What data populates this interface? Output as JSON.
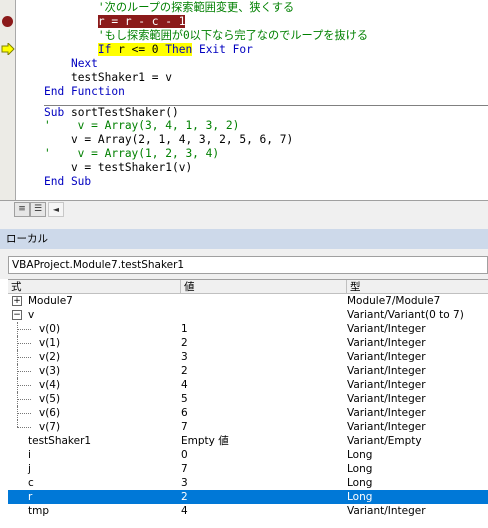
{
  "code": {
    "lines": [
      {
        "indent": "        ",
        "comment": "'次のループの探索範囲変更、狭くする"
      },
      {
        "indent": "        ",
        "hl_red": "r = r - c - 1"
      },
      {
        "indent": "        ",
        "comment": "'もし探索範囲が0以下なら完了なのでループを抜ける"
      },
      {
        "indent": "        ",
        "kw_if": "If",
        "expr": " r <= 0 ",
        "kw_then": "Then",
        "rest": " Exit For"
      },
      {
        "indent": "    ",
        "kw": "Next"
      },
      {
        "indent": "    ",
        "plain": "testShaker1 = v"
      },
      {
        "indent": "",
        "kw": "End Function"
      },
      {
        "indent": "",
        "kw": "Sub",
        "plain": " sortTestShaker()"
      },
      {
        "indent": "",
        "comment": "'    v = Array(3, 4, 1, 3, 2)"
      },
      {
        "indent": "    ",
        "plain": "v = Array(2, 1, 4, 3, 2, 5, 6, 7)"
      },
      {
        "indent": "",
        "comment": "'    v = Array(1, 2, 3, 4)"
      },
      {
        "indent": "    ",
        "plain": "v = testShaker1(v)"
      },
      {
        "indent": "",
        "kw": "End Sub"
      }
    ],
    "view_buttons": [
      "≡",
      "☰"
    ],
    "scroll_left": "◄"
  },
  "locals": {
    "title": "ローカル",
    "context": "VBAProject.Module7.testShaker1",
    "headers": {
      "name": "式",
      "value": "値",
      "type": "型"
    },
    "rows": [
      {
        "expander": "+",
        "name": "Module7",
        "value": "",
        "type": "Module7/Module7"
      },
      {
        "expander": "−",
        "name": "v",
        "value": "",
        "type": "Variant/Variant(0 to 7)"
      },
      {
        "child": true,
        "name": "v(0)",
        "value": "1",
        "type": "Variant/Integer"
      },
      {
        "child": true,
        "name": "v(1)",
        "value": "2",
        "type": "Variant/Integer"
      },
      {
        "child": true,
        "name": "v(2)",
        "value": "3",
        "type": "Variant/Integer"
      },
      {
        "child": true,
        "name": "v(3)",
        "value": "2",
        "type": "Variant/Integer"
      },
      {
        "child": true,
        "name": "v(4)",
        "value": "4",
        "type": "Variant/Integer"
      },
      {
        "child": true,
        "name": "v(5)",
        "value": "5",
        "type": "Variant/Integer"
      },
      {
        "child": true,
        "name": "v(6)",
        "value": "6",
        "type": "Variant/Integer"
      },
      {
        "child": true,
        "name": "v(7)",
        "value": "7",
        "type": "Variant/Integer"
      },
      {
        "name": "testShaker1",
        "value": "Empty 値",
        "type": "Variant/Empty"
      },
      {
        "name": "i",
        "value": "0",
        "type": "Long"
      },
      {
        "name": "j",
        "value": "7",
        "type": "Long"
      },
      {
        "name": "c",
        "value": "3",
        "type": "Long"
      },
      {
        "name": "r",
        "value": "2",
        "type": "Long",
        "selected": true
      },
      {
        "name": "tmp",
        "value": "4",
        "type": "Variant/Integer"
      }
    ]
  }
}
